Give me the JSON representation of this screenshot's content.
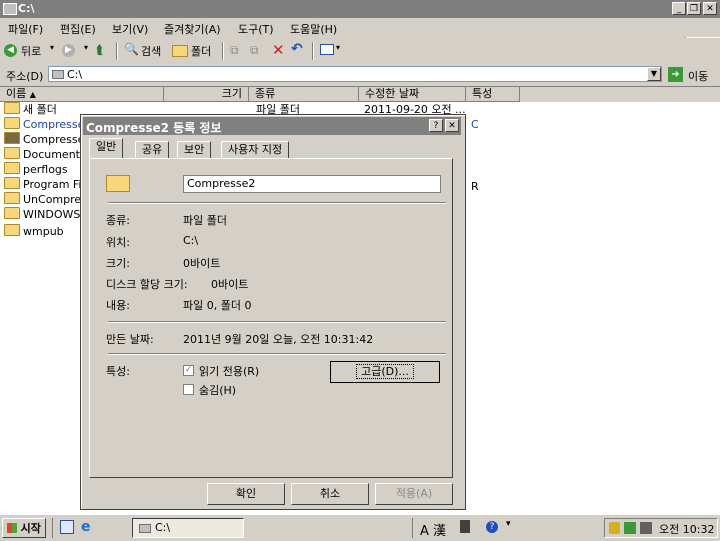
{
  "window": {
    "title": "C:\\"
  },
  "menu": [
    "파일(F)",
    "편집(E)",
    "보기(V)",
    "즐겨찾기(A)",
    "도구(T)",
    "도움말(H)"
  ],
  "toolbar": {
    "back": "뒤로",
    "search": "검색",
    "folders": "폴더"
  },
  "address": {
    "label": "주소(D)",
    "value": "C:\\",
    "go": "이동"
  },
  "columns": [
    "이름",
    "크기",
    "종류",
    "수정한 날짜",
    "특성"
  ],
  "files": [
    {
      "name": "새 폴더",
      "type": "파일 폴더",
      "date": "2011-09-20 오전 ...",
      "attr": ""
    },
    {
      "name": "Compresse",
      "type": "",
      "date": "",
      "attr": "C"
    },
    {
      "name": "Compresse",
      "type": "",
      "date": "",
      "attr": ""
    },
    {
      "name": "Documents",
      "type": "",
      "date": "",
      "attr": ""
    },
    {
      "name": "perflogs",
      "type": "",
      "date": "",
      "attr": ""
    },
    {
      "name": "Program Fil",
      "type": "",
      "date": "",
      "attr": "R"
    },
    {
      "name": "UnCompres",
      "type": "",
      "date": "",
      "attr": ""
    },
    {
      "name": "WINDOWS",
      "type": "",
      "date": "",
      "attr": ""
    },
    {
      "name": "wmpub",
      "type": "",
      "date": "",
      "attr": ""
    }
  ],
  "dialog": {
    "title": "Compresse2 등록 정보",
    "help": "?",
    "tabs": [
      "일반",
      "공유",
      "보안",
      "사용자 지정"
    ],
    "name_value": "Compresse2",
    "labels": {
      "type": "종류:",
      "location": "위치:",
      "size": "크기:",
      "disk_size": "디스크 할당 크기:",
      "contents": "내용:",
      "created": "만든 날짜:",
      "attributes": "특성:"
    },
    "values": {
      "type": "파일 폴더",
      "location": "C:\\",
      "size": "0바이트",
      "disk_size": "0바이트",
      "contents": "파일 0, 폴더 0",
      "created": "2011년 9월 20일 오늘, 오전 10:31:42"
    },
    "readonly_label": "읽기 전용(R)",
    "hidden_label": "숨김(H)",
    "advanced_button": "고급(D)...",
    "ok": "확인",
    "cancel": "취소",
    "apply": "적용(A)"
  },
  "taskbar": {
    "start": "시작",
    "task": "C:\\",
    "ime": "A 漢",
    "clock": "오전 10:32"
  }
}
